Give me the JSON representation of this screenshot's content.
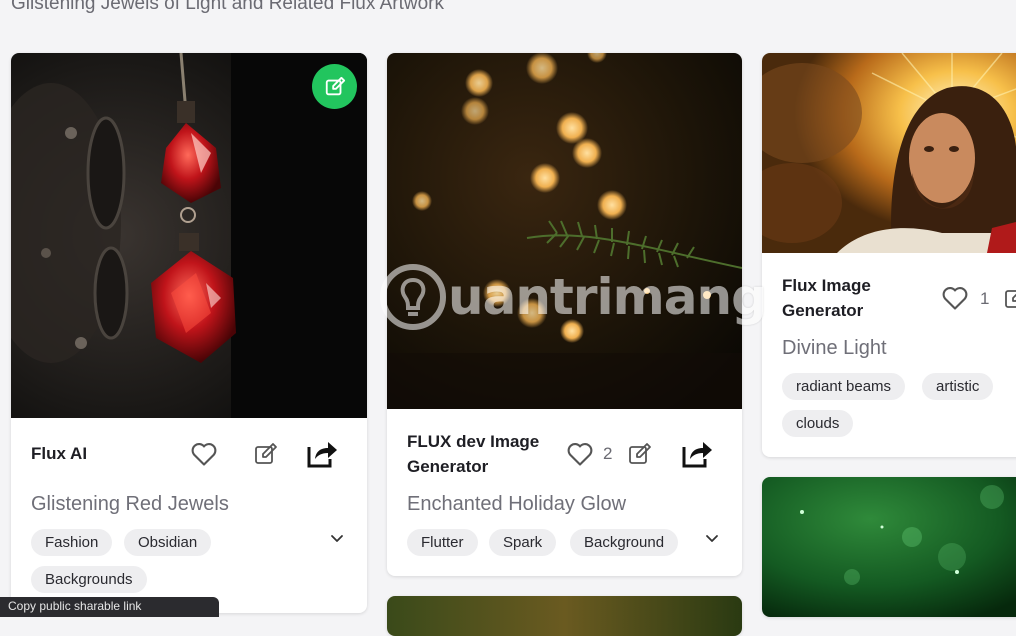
{
  "page": {
    "heading": "Glistening Jewels of Light and Related Flux Artwork",
    "tooltip_text": "Copy public sharable link"
  },
  "watermark": {
    "text": "uantrimang"
  },
  "colors": {
    "accent_green": "#22c55e",
    "tag_bg": "#eeeef0",
    "card_bg": "#ffffff",
    "page_bg": "#f4f4f6"
  },
  "cards": [
    {
      "source": "Flux AI",
      "title": "Glistening Red Jewels",
      "like_count": "",
      "tags": [
        "Fashion",
        "Obsidian",
        "Backgrounds"
      ],
      "icons": [
        "heart-icon",
        "edit-icon",
        "share-icon",
        "chevron-down-icon"
      ]
    },
    {
      "source_line1": "FLUX dev Image",
      "source_line2": "Generator",
      "title": "Enchanted Holiday Glow",
      "like_count": "2",
      "tags": [
        "Flutter",
        "Spark",
        "Background"
      ],
      "icons": [
        "heart-icon",
        "edit-icon",
        "share-icon",
        "chevron-down-icon"
      ]
    },
    {
      "source_line1": "Flux Image",
      "source_line2": "Generator",
      "title": "Divine Light",
      "like_count": "1",
      "tags": [
        "radiant beams",
        "artistic",
        "clouds"
      ],
      "icons": [
        "heart-icon",
        "edit-icon"
      ]
    }
  ]
}
